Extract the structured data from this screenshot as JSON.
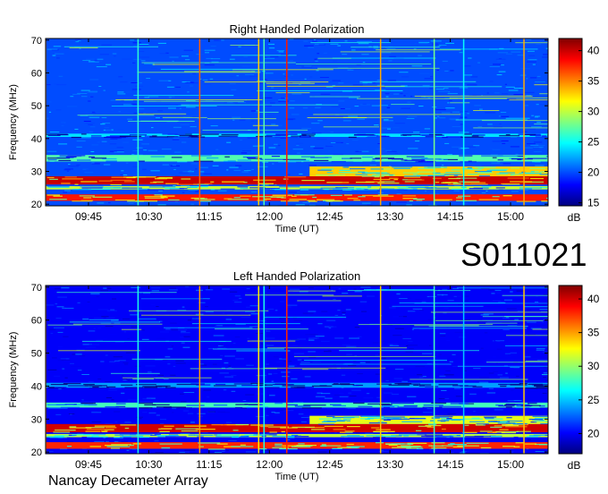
{
  "header": {
    "event_id": "S011021",
    "instrument": "Nancay Decameter Array"
  },
  "colorbar": {
    "unit_label": "dB",
    "colors": [
      "#00007f",
      "#0000ff",
      "#007fff",
      "#00ffff",
      "#7fff7f",
      "#ffff00",
      "#ff7f00",
      "#ff0000",
      "#7f0000"
    ]
  },
  "chart_data": [
    {
      "type": "heatmap",
      "title": "Right Handed Polarization",
      "xlabel": "Time (UT)",
      "ylabel": "Frequency (MHz)",
      "x_ticks": [
        "09:45",
        "10:30",
        "11:15",
        "12:00",
        "12:45",
        "13:30",
        "14:15",
        "15:00"
      ],
      "x_tick_minutes": [
        585,
        630,
        675,
        720,
        765,
        810,
        855,
        900
      ],
      "x_range_minutes": [
        553,
        928
      ],
      "y_ticks": [
        20,
        30,
        40,
        50,
        60,
        70
      ],
      "ylim": [
        19.5,
        70.5
      ],
      "colorbar_ticks": [
        15,
        20,
        25,
        30,
        35,
        40
      ],
      "colorbar_range": [
        14.5,
        42
      ],
      "bright_bands": [
        {
          "freq_range": [
            26,
            28.5
          ],
          "time_range": [
            553,
            928
          ],
          "level": 40
        },
        {
          "freq_range": [
            21,
            23
          ],
          "time_range": [
            553,
            928
          ],
          "level": 38
        },
        {
          "freq_range": [
            24.5,
            25.5
          ],
          "time_range": [
            553,
            928
          ],
          "level": 30
        },
        {
          "freq_range": [
            33,
            35
          ],
          "time_range": [
            553,
            928
          ],
          "level": 27
        },
        {
          "freq_range": [
            28.5,
            31.5
          ],
          "time_range": [
            750,
            928
          ],
          "level": 33
        },
        {
          "freq_range": [
            40.5,
            41.5
          ],
          "time_range": [
            553,
            928
          ],
          "level": 24
        }
      ],
      "vertical_events": [
        {
          "time": 553,
          "level": 35
        },
        {
          "time": 622,
          "level": 26
        },
        {
          "time": 668,
          "level": 36
        },
        {
          "time": 712,
          "level": 33
        },
        {
          "time": 716,
          "level": 27
        },
        {
          "time": 733,
          "level": 38
        },
        {
          "time": 803,
          "level": 34
        },
        {
          "time": 843,
          "level": 28
        },
        {
          "time": 865,
          "level": 25
        },
        {
          "time": 910,
          "level": 34
        }
      ]
    },
    {
      "type": "heatmap",
      "title": "Left Handed Polarization",
      "xlabel": "Time (UT)",
      "ylabel": "Frequency (MHz)",
      "x_ticks": [
        "09:45",
        "10:30",
        "11:15",
        "12:00",
        "12:45",
        "13:30",
        "14:15",
        "15:00"
      ],
      "x_tick_minutes": [
        585,
        630,
        675,
        720,
        765,
        810,
        855,
        900
      ],
      "x_range_minutes": [
        553,
        928
      ],
      "y_ticks": [
        20,
        30,
        40,
        50,
        60,
        70
      ],
      "ylim": [
        19.5,
        70.5
      ],
      "colorbar_ticks": [
        20,
        25,
        30,
        35,
        40
      ],
      "colorbar_range": [
        17,
        42
      ],
      "bright_bands": [
        {
          "freq_range": [
            26,
            28.5
          ],
          "time_range": [
            553,
            928
          ],
          "level": 40
        },
        {
          "freq_range": [
            21,
            23
          ],
          "time_range": [
            553,
            928
          ],
          "level": 38
        },
        {
          "freq_range": [
            24.5,
            25.5
          ],
          "time_range": [
            553,
            928
          ],
          "level": 31
        },
        {
          "freq_range": [
            33.5,
            35
          ],
          "time_range": [
            553,
            928
          ],
          "level": 28
        },
        {
          "freq_range": [
            28.5,
            31
          ],
          "time_range": [
            750,
            928
          ],
          "level": 32
        },
        {
          "freq_range": [
            39.5,
            41
          ],
          "time_range": [
            553,
            928
          ],
          "level": 24
        }
      ],
      "vertical_events": [
        {
          "time": 553,
          "level": 35
        },
        {
          "time": 622,
          "level": 27
        },
        {
          "time": 668,
          "level": 35
        },
        {
          "time": 712,
          "level": 33
        },
        {
          "time": 716,
          "level": 27
        },
        {
          "time": 733,
          "level": 38
        },
        {
          "time": 803,
          "level": 34
        },
        {
          "time": 843,
          "level": 28
        },
        {
          "time": 865,
          "level": 25
        },
        {
          "time": 910,
          "level": 34
        }
      ]
    }
  ]
}
